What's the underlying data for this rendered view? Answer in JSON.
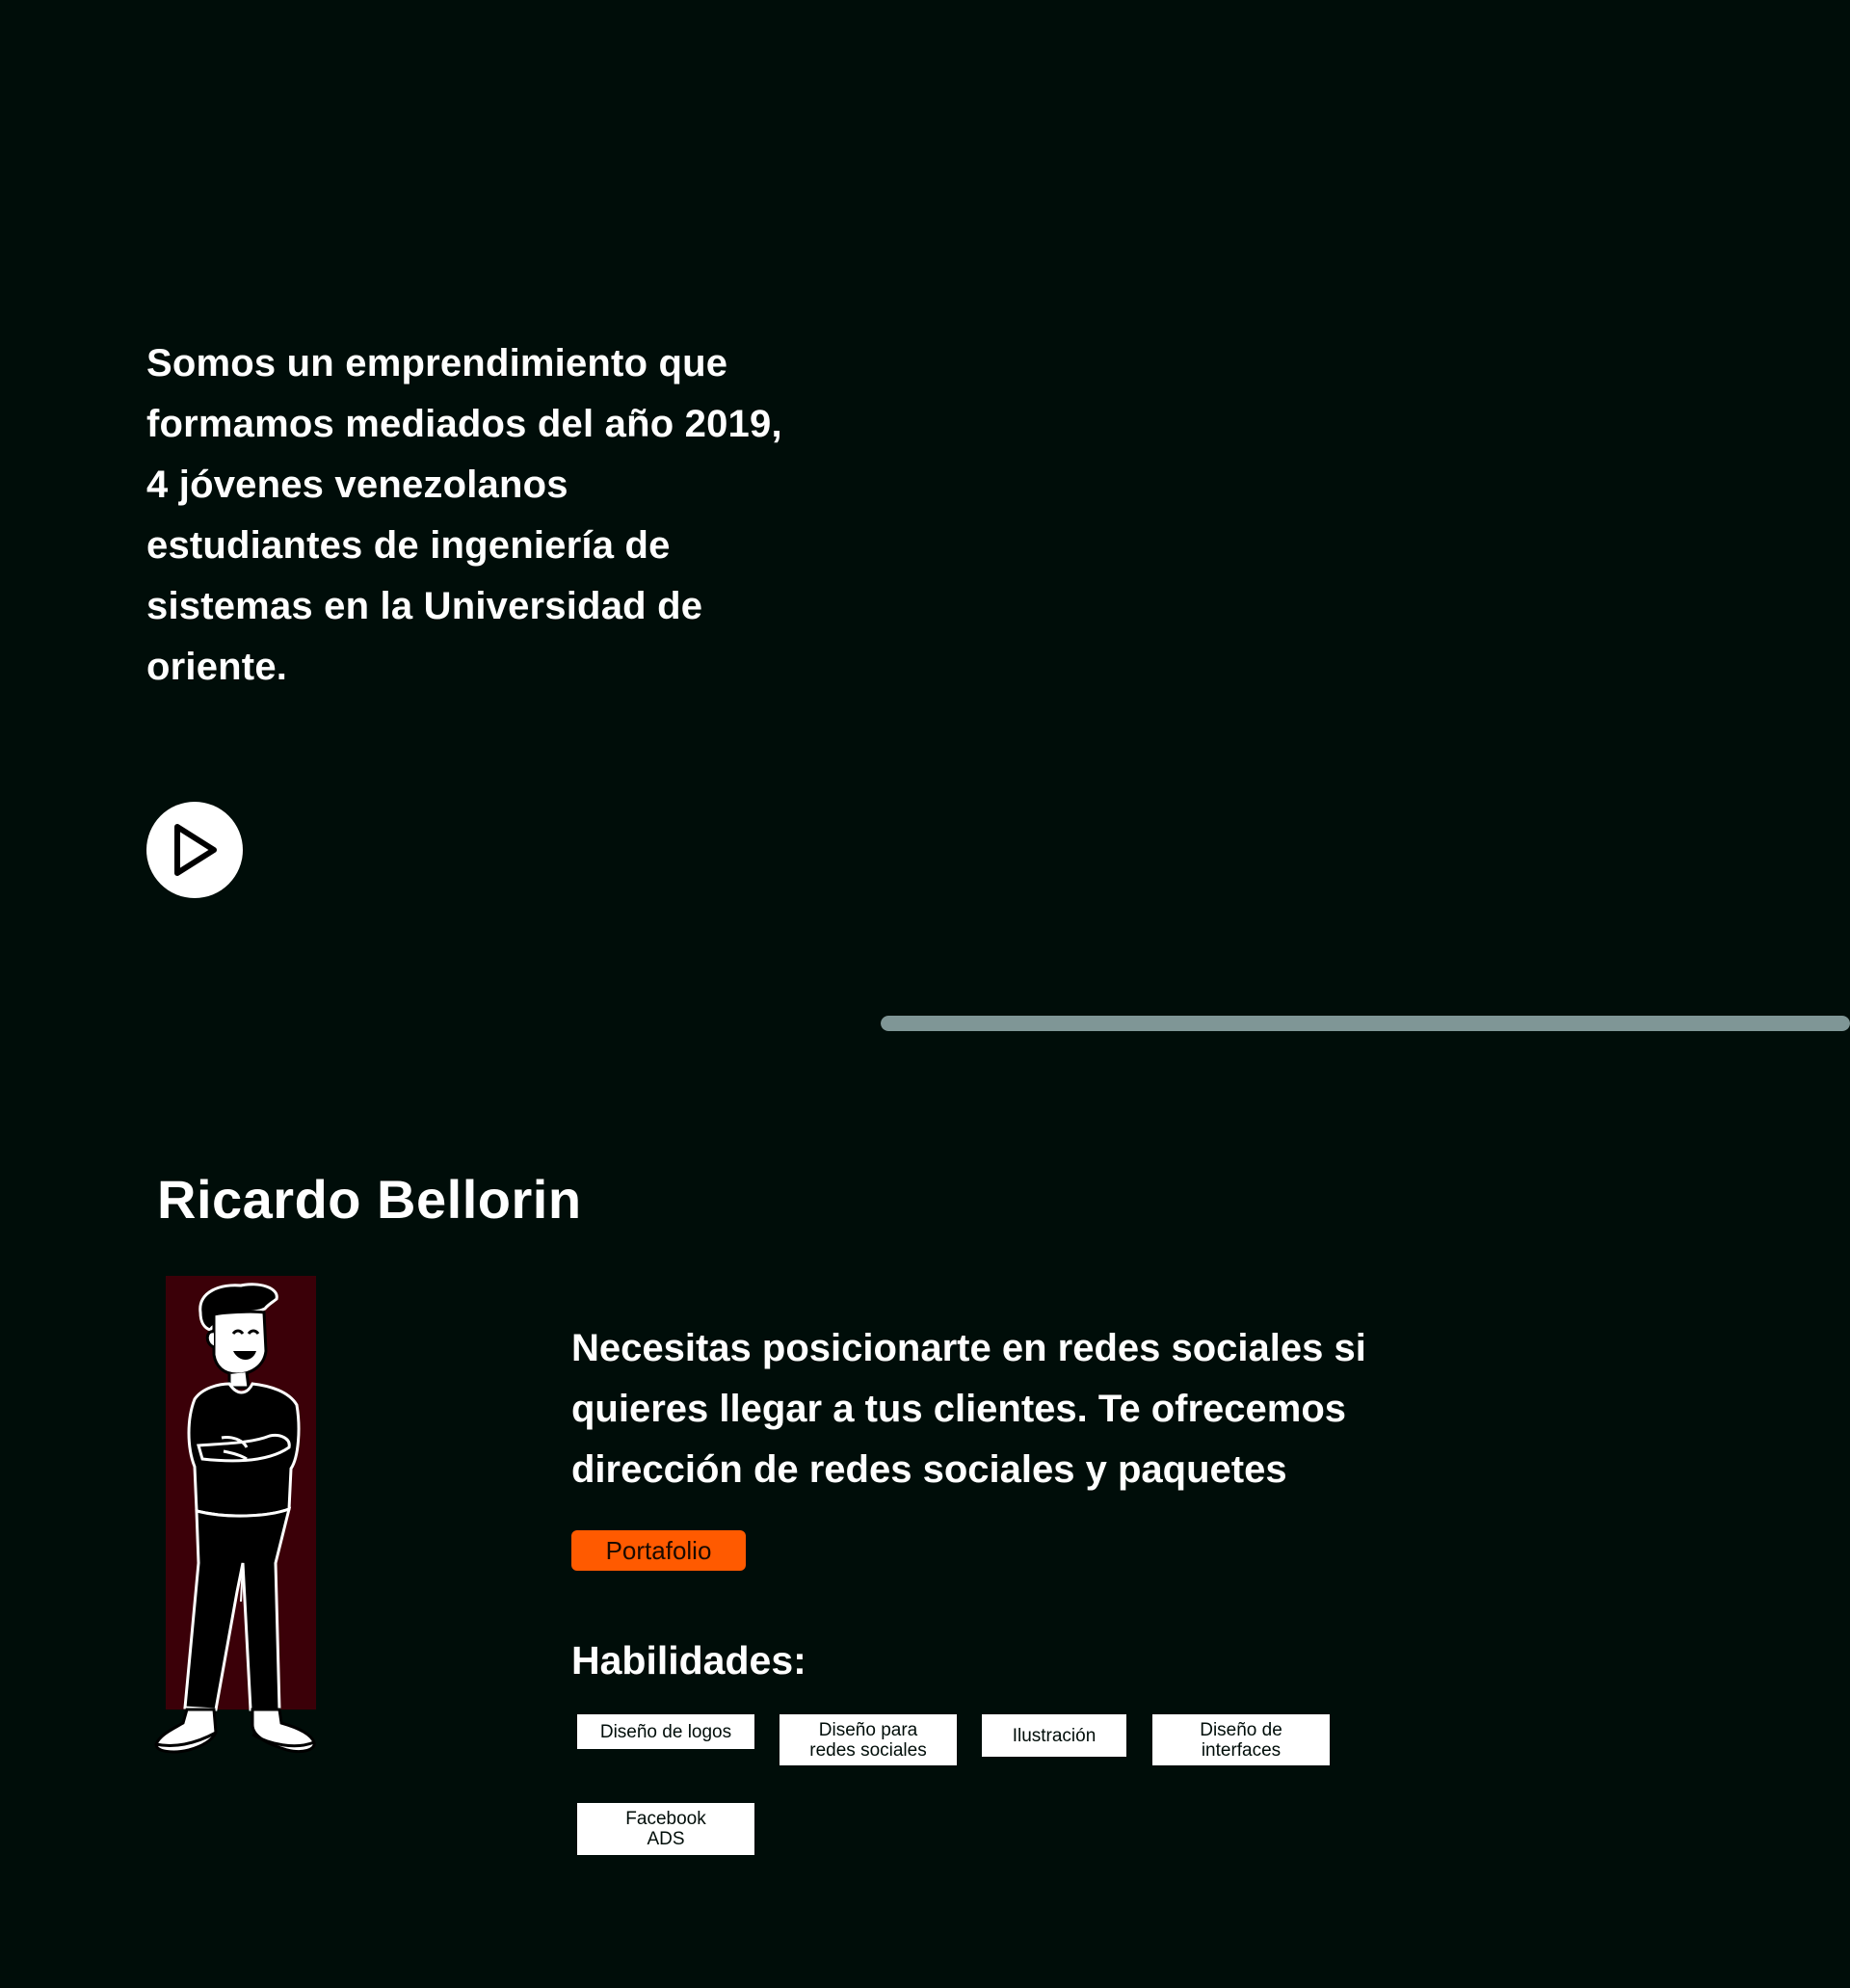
{
  "intro": {
    "text": "Somos un emprendimiento que formamos mediados del año 2019, 4 jóvenes venezolanos estudiantes de ingeniería de sistemas en la Universidad de oriente."
  },
  "video": {
    "play_icon": "play-icon",
    "progress_fraction": 1.0
  },
  "member": {
    "name": "Ricardo Bellorin",
    "description": "Necesitas posicionarte en redes sociales si quieres llegar a tus clientes. Te ofrecemos dirección de redes sociales y paquetes",
    "portfolio_label": "Portafolio",
    "skills_title": "Habilidades:",
    "skills": [
      "Diseño de logos",
      "Diseño para redes sociales",
      "Ilustración",
      "Diseño de interfaces",
      "Facebook ADS"
    ]
  },
  "colors": {
    "background": "#000d09",
    "accent": "#ff5a00",
    "avatar_panel": "#3b0008",
    "progress": "#7f9696"
  }
}
